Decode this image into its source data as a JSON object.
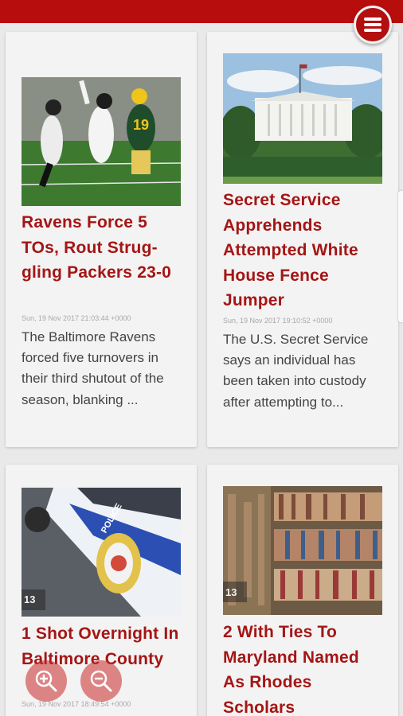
{
  "colors": {
    "brand_red": "#b80d0d",
    "title_red": "#a51515"
  },
  "menu": {
    "icon": "hamburger-menu-icon"
  },
  "zoom": {
    "in_icon": "zoom-in-icon",
    "out_icon": "zoom-out-icon"
  },
  "articles": [
    {
      "title": "Ravens Force 5 TOs, Rout Strug-gling Packers 23-0",
      "date": "Sun, 19 Nov 2017 21:03:44 +0000",
      "summary": "The Baltimore Ravens forced five turnovers in their third shutout of the season, blanking ...",
      "image": "football-game-photo"
    },
    {
      "title": "Secret Service Apprehends Attempted White House Fence Jumper",
      "date": "Sun, 19 Nov 2017 19:10:52 +0000",
      "summary": "The U.S. Secret Service says an individual has been taken into custody after attempting to...",
      "image": "white-house-photo"
    },
    {
      "title": "1 Shot Overnight In Baltimore County",
      "date": "Sun, 19 Nov 2017 18:49:54 +0000",
      "summary": "",
      "image": "police-car-photo",
      "watermark": "13"
    },
    {
      "title": "2 With Ties To Maryland Named As Rhodes Scholars",
      "date": "",
      "summary": "",
      "image": "library-books-photo",
      "watermark": "13"
    }
  ]
}
